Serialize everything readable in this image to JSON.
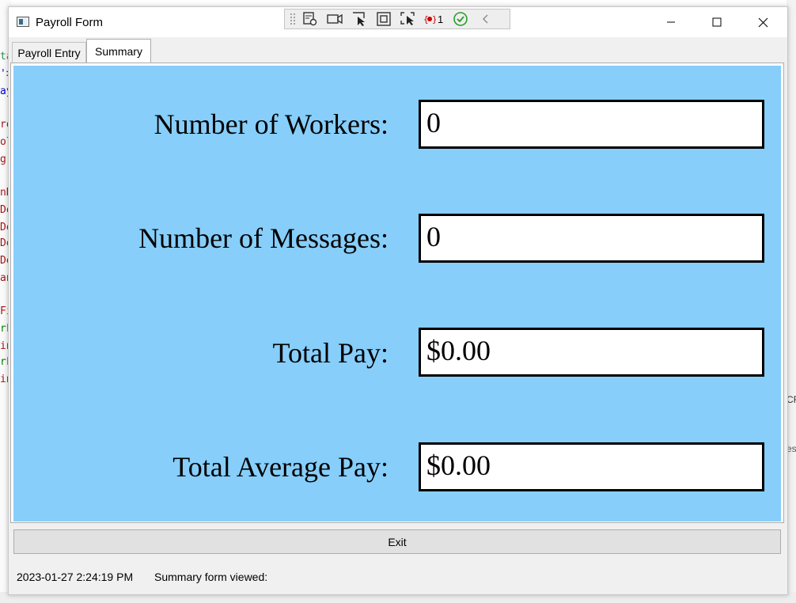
{
  "window": {
    "title": "Payroll Form"
  },
  "tabs": [
    {
      "label": "Payroll Entry",
      "selected": false
    },
    {
      "label": "Summary",
      "selected": true
    }
  ],
  "debug_toolbar": {
    "error_count": "1"
  },
  "summary": {
    "panel_color": "#87cefa",
    "workers_label": "Number of Workers:",
    "workers_value": "0",
    "messages_label": "Number of Messages:",
    "messages_value": "0",
    "total_pay_label": "Total Pay:",
    "total_pay_value": "$0.00",
    "average_pay_label": "Total Average Pay:",
    "average_pay_value": "$0.00"
  },
  "exit_label": "Exit",
  "status_bar": {
    "timestamp": "2023-01-27 2:24:19 PM",
    "message": "Summary form viewed:"
  },
  "background_editor": {
    "code_fragments": [
      "ta",
      "'>",
      "ay",
      "ro",
      "ol",
      "gr",
      "nD",
      "De",
      "De",
      "De",
      "De",
      "an",
      "Fi",
      "rk",
      "in",
      "rk",
      "in"
    ],
    "right_fragments": [
      "CR",
      "ess"
    ]
  }
}
